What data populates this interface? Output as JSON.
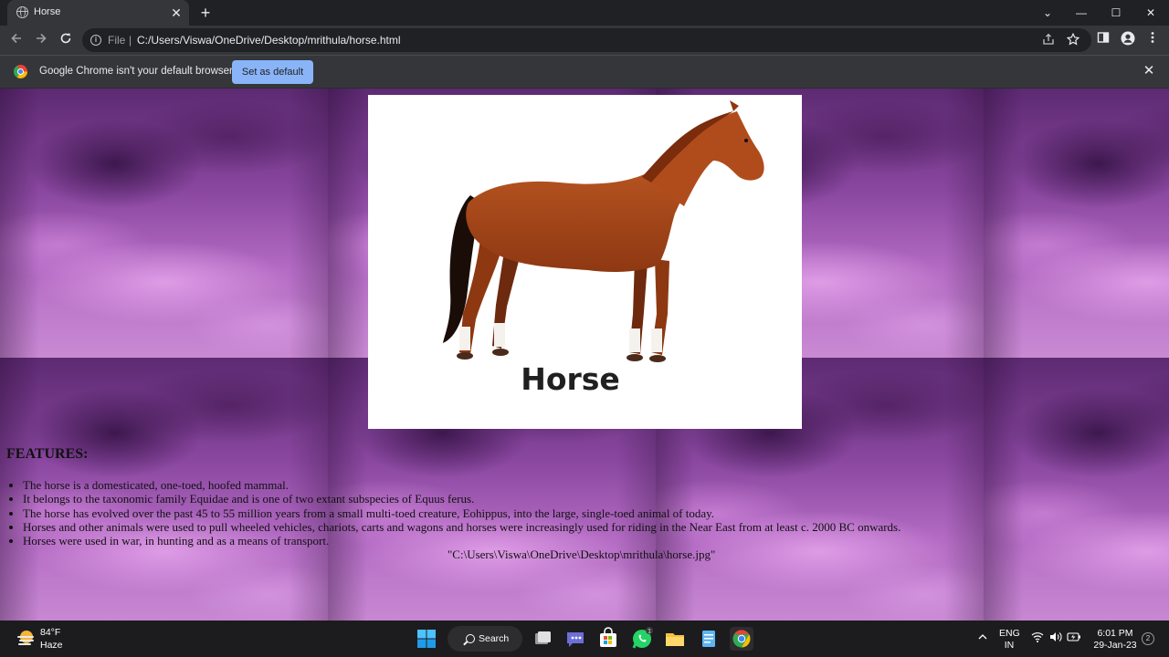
{
  "browser": {
    "tab_title": "Horse",
    "tab_close": "✕",
    "new_tab": "+",
    "window_controls": [
      "⌄",
      "—",
      "☐",
      "✕"
    ],
    "omnibox_scheme": "File",
    "omnibox_separator": "|",
    "omnibox_url": "C:/Users/Viswa/OneDrive/Desktop/mrithula/horse.html",
    "infobar_text": "Google Chrome isn't your default browser",
    "infobar_button": "Set as default",
    "infobar_close": "✕"
  },
  "page": {
    "image_caption": "Horse",
    "features_heading": "FEATURES:",
    "features": [
      "The horse is a domesticated, one-toed, hoofed mammal.",
      "It belongs to the taxonomic family Equidae and is one of two extant subspecies of Equus ferus.",
      "The horse has evolved over the past 45 to 55 million years from a small multi-toed creature, Eohippus, into the large, single-toed animal of today.",
      "Horses and other animals were used to pull wheeled vehicles, chariots, carts and wagons and horses were increasingly used for riding in the Near East from at least c. 2000 BC onwards.",
      "Horses were used in war, in hunting and as a means of transport."
    ],
    "image_path_text": "\"C:\\Users\\Viswa\\OneDrive\\Desktop\\mrithula\\horse.jpg\""
  },
  "taskbar": {
    "weather_temp": "84°F",
    "weather_condition": "Haze",
    "search_label": "Search",
    "whatsapp_badge": "1",
    "language": "ENG",
    "region": "IN",
    "time": "6:01 PM",
    "date": "29-Jan-23",
    "notification_count": "2"
  }
}
